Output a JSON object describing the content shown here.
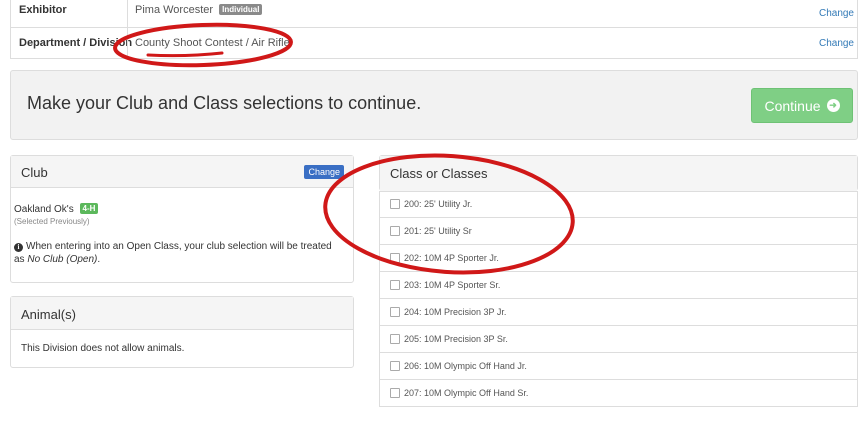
{
  "exhibitor_row": {
    "label": "Exhibitor",
    "value": "Pima Worcester",
    "badge": "Individual",
    "change": "Change"
  },
  "division_row": {
    "label": "Department / Division",
    "department": "County Shoot Contest",
    "separator": "/",
    "division": "Air Rifle",
    "change": "Change"
  },
  "prompt": {
    "message": "Make your Club and Class selections to continue.",
    "continue_label": "Continue"
  },
  "club_panel": {
    "title": "Club",
    "change_label": "Change",
    "club_name": "Oakland Ok's",
    "club_badge": "4-H",
    "selected_note": "(Selected Previously)",
    "info_text_1": "When entering into an Open Class, your club selection will be treated as ",
    "info_text_em": "No Club (Open)",
    "info_text_2": "."
  },
  "animals_panel": {
    "title": "Animal(s)",
    "message": "This Division does not allow animals."
  },
  "classes_panel": {
    "title": "Class or Classes",
    "items": [
      "200: 25' Utility Jr.",
      "201: 25' Utility Sr",
      "202: 10M 4P Sporter Jr.",
      "203: 10M 4P Sporter Sr.",
      "204: 10M Precision 3P Jr.",
      "205: 10M Precision 3P Sr.",
      "206: 10M Olympic Off Hand Jr.",
      "207: 10M Olympic Off Hand Sr."
    ]
  },
  "colors": {
    "link": "#337ab7",
    "continue_bg": "#7fcf85",
    "annotation_red": "#d01818",
    "change_button": "#3a6fc4",
    "badge_4h": "#5cb85c"
  }
}
